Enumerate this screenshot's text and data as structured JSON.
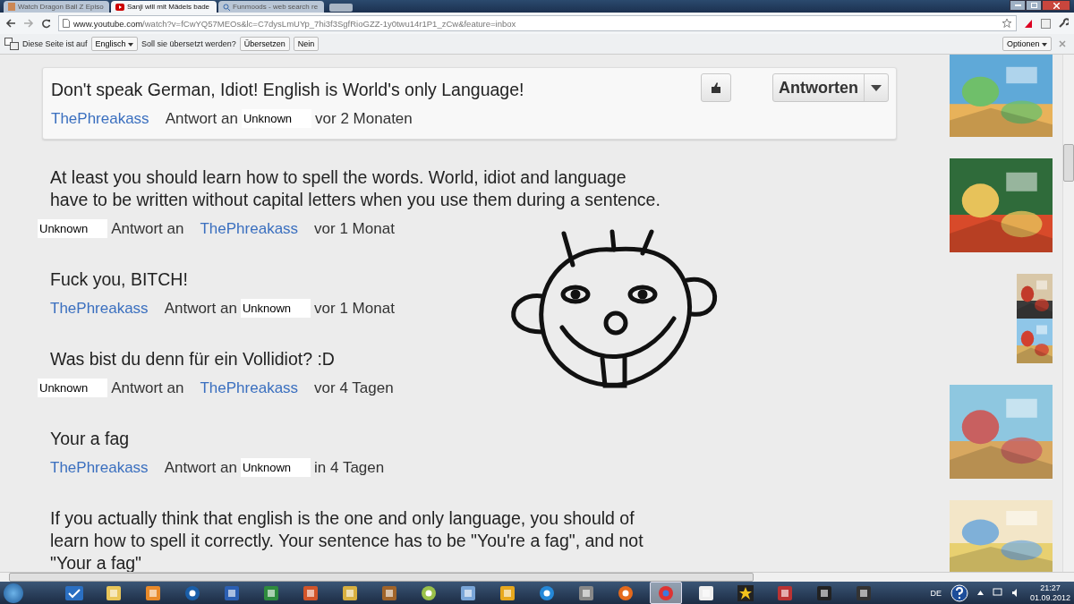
{
  "tabs": [
    {
      "label": "Watch Dragon Ball Z Episo",
      "selected": false
    },
    {
      "label": "Sanji will mit Mädels bade",
      "selected": true
    },
    {
      "label": "Funmoods - web search re",
      "selected": false
    }
  ],
  "address": {
    "host": "www.youtube.com",
    "path": "/watch?v=fCwYQ57MEOs&lc=C7dysLmUYp_7hi3f3SgfRioGZZ-1y0twu14r1P1_zCw&feature=inbox"
  },
  "translate_bar": {
    "prefix": "Diese Seite ist auf",
    "language": "Englisch",
    "question": "Soll sie übersetzt werden?",
    "translate": "Übersetzen",
    "decline": "Nein",
    "options": "Optionen"
  },
  "comments": [
    {
      "text": "Don't speak German, Idiot! English is World's only Language!",
      "kind": "featured",
      "reply_button": "Antworten",
      "meta": [
        {
          "kind": "link",
          "text": "ThePhreakass"
        },
        {
          "kind": "plain",
          "text": "Antwort an"
        },
        {
          "kind": "redacted",
          "text": "Unknown"
        },
        {
          "kind": "plain",
          "text": "vor 2 Monaten"
        }
      ]
    },
    {
      "text": "At least you should learn how to spell the words. World, idiot and language have to be written without capital letters when you use them during a sentence.",
      "kind": "reply",
      "meta": [
        {
          "kind": "redacted",
          "text": "Unknown"
        },
        {
          "kind": "plain",
          "text": "Antwort an"
        },
        {
          "kind": "link",
          "text": "ThePhreakass"
        },
        {
          "kind": "plain",
          "text": "vor 1 Monat"
        }
      ]
    },
    {
      "text": "Fuck you, BITCH!",
      "kind": "reply",
      "meta": [
        {
          "kind": "link",
          "text": "ThePhreakass"
        },
        {
          "kind": "plain",
          "text": "Antwort an"
        },
        {
          "kind": "redacted",
          "text": "Unknown"
        },
        {
          "kind": "plain",
          "text": "vor 1 Monat"
        }
      ]
    },
    {
      "text": "Was bist du denn für ein Vollidiot? :D",
      "kind": "reply",
      "meta": [
        {
          "kind": "redacted",
          "text": "Unknown"
        },
        {
          "kind": "plain",
          "text": "Antwort an"
        },
        {
          "kind": "link",
          "text": "ThePhreakass"
        },
        {
          "kind": "plain",
          "text": "vor 4 Tagen"
        }
      ]
    },
    {
      "text": "Your a fag",
      "kind": "reply",
      "meta": [
        {
          "kind": "link",
          "text": "ThePhreakass"
        },
        {
          "kind": "plain",
          "text": "Antwort an"
        },
        {
          "kind": "redacted",
          "text": "Unknown"
        },
        {
          "kind": "plain",
          "text": "in 4 Tagen"
        }
      ]
    },
    {
      "text": "If you actually think that english is the one and only language, you should of learn how to spell it correctly. Your sentence has to be \"You're a fag\", and not \"Your a fag\"",
      "kind": "reply"
    }
  ],
  "taskbar": {
    "apps": [
      {
        "kind": "check",
        "selected": false
      },
      {
        "kind": "folder",
        "selected": false
      },
      {
        "kind": "media",
        "selected": false
      },
      {
        "kind": "hp",
        "selected": false
      },
      {
        "kind": "word",
        "selected": false
      },
      {
        "kind": "excel",
        "selected": false
      },
      {
        "kind": "powerpoint",
        "selected": false
      },
      {
        "kind": "keys",
        "selected": false
      },
      {
        "kind": "film",
        "selected": false
      },
      {
        "kind": "ball",
        "selected": false
      },
      {
        "kind": "paint",
        "selected": false
      },
      {
        "kind": "pinwheel",
        "selected": false
      },
      {
        "kind": "disc",
        "selected": false
      },
      {
        "kind": "pen",
        "selected": false
      },
      {
        "kind": "firefox",
        "selected": false
      },
      {
        "kind": "chrome",
        "selected": true
      },
      {
        "kind": "window",
        "selected": false
      },
      {
        "kind": "star",
        "selected": false
      },
      {
        "kind": "mask",
        "selected": false
      },
      {
        "kind": "dark",
        "selected": false
      },
      {
        "kind": "game",
        "selected": false
      }
    ],
    "language": "DE",
    "time": "21:27",
    "date": "01.09.2012"
  }
}
